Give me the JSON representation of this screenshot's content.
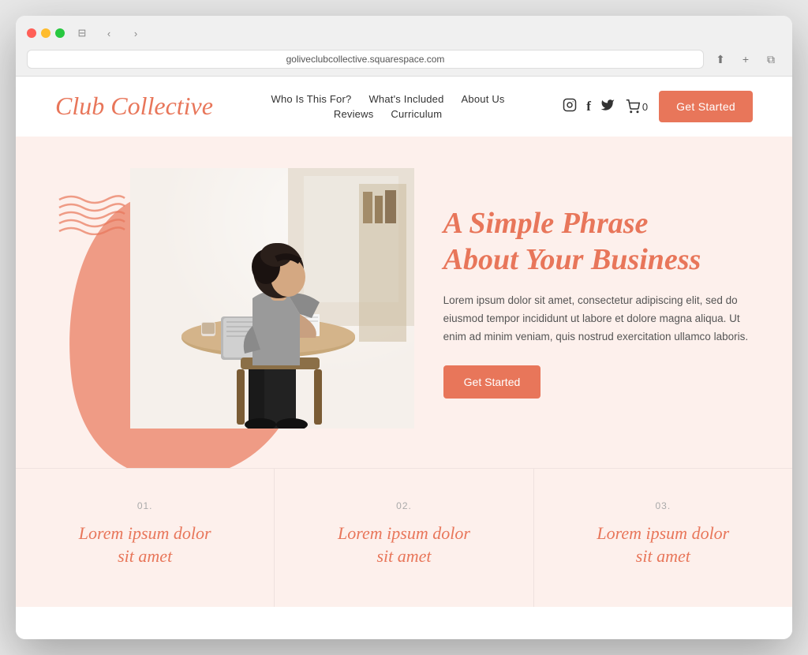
{
  "browser": {
    "url": "goliveclubcollective.squarespace.com",
    "back_btn": "‹",
    "forward_btn": "›",
    "refresh_icon": "↻",
    "share_icon": "⬆",
    "new_tab_icon": "+",
    "copy_icon": "⧉",
    "sidebar_icon": "⊟"
  },
  "header": {
    "logo": "Club Collective",
    "nav": {
      "row1": [
        {
          "label": "Who Is This For?",
          "href": "#"
        },
        {
          "label": "What's Included",
          "href": "#"
        },
        {
          "label": "About Us",
          "href": "#"
        }
      ],
      "row2": [
        {
          "label": "Reviews",
          "href": "#"
        },
        {
          "label": "Curriculum",
          "href": "#"
        }
      ]
    },
    "social": {
      "instagram": "📷",
      "facebook": "f",
      "twitter": "🐦"
    },
    "cart_count": "0",
    "cta_label": "Get Started"
  },
  "hero": {
    "headline_line1": "A Simple Phrase",
    "headline_line2": "About Your Business",
    "body": "Lorem ipsum dolor sit amet, consectetur adipiscing elit, sed do eiusmod tempor incididunt ut labore et dolore magna aliqua. Ut enim ad minim veniam, quis nostrud exercitation ullamco laboris.",
    "cta_label": "Get Started"
  },
  "features": [
    {
      "number": "01.",
      "title_line1": "Lorem ipsum dolor",
      "title_line2": "sit amet"
    },
    {
      "number": "02.",
      "title_line1": "Lorem ipsum dolor",
      "title_line2": "sit amet"
    },
    {
      "number": "03.",
      "title_line1": "Lorem ipsum dolor",
      "title_line2": "sit amet"
    }
  ],
  "colors": {
    "coral": "#e8765a",
    "light_bg": "#fdf0ec",
    "text_dark": "#333333",
    "text_muted": "#888888"
  }
}
